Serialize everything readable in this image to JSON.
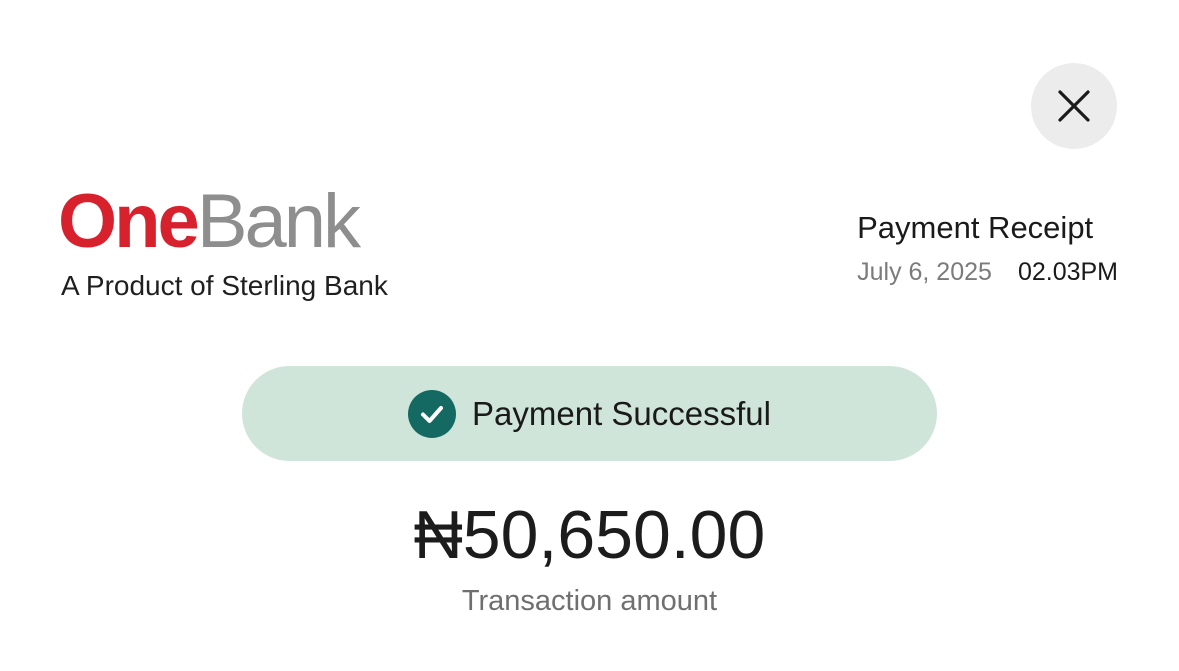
{
  "close": {
    "icon": "close-icon"
  },
  "brand": {
    "logo_part1": "One",
    "logo_part2": "Bank",
    "tagline": "A Product of Sterling Bank",
    "colors": {
      "one": "#d7222e",
      "bank": "#8e8e8e"
    }
  },
  "receipt": {
    "title": "Payment Receipt",
    "date": "July 6, 2025",
    "time": "02.03PM"
  },
  "status": {
    "icon": "check-circle-icon",
    "text": "Payment Successful",
    "pill_color": "#cfe5d9",
    "icon_color": "#146a62"
  },
  "transaction": {
    "amount": "₦50,650.00",
    "label": "Transaction amount"
  }
}
